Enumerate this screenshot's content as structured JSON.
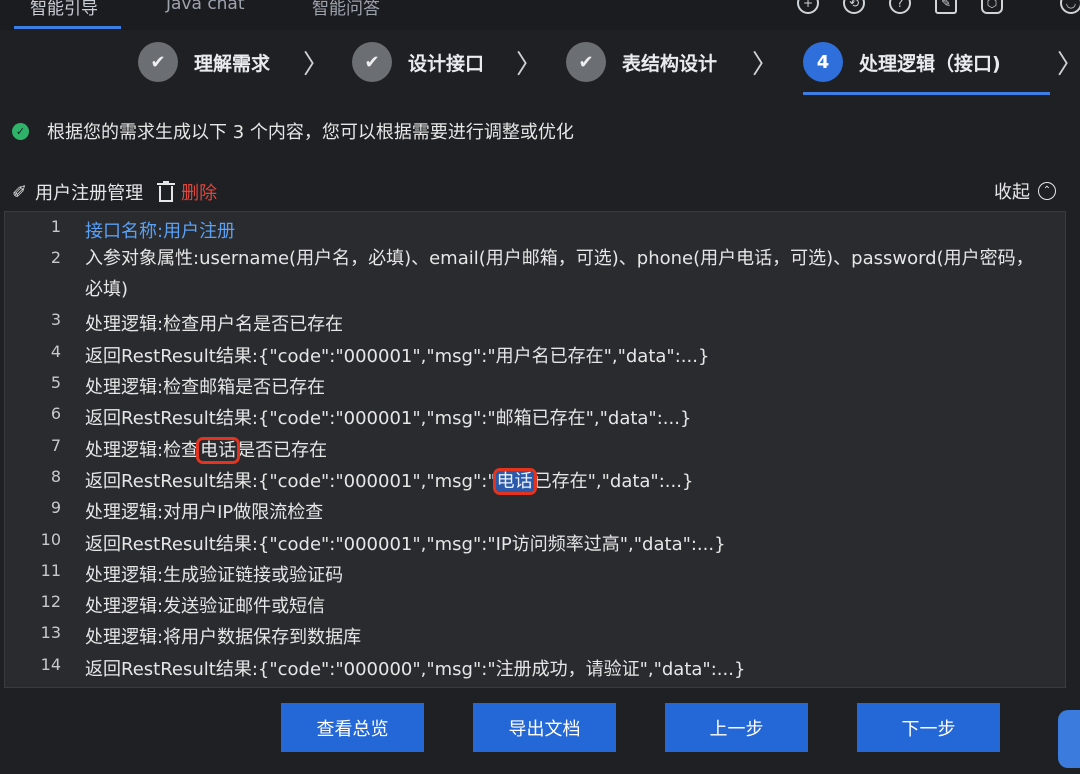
{
  "topnav": {
    "tabs": [
      "智能引导",
      "Java chat",
      "智能问答"
    ],
    "icons": [
      "add-icon",
      "history-icon",
      "help-icon",
      "edit-icon",
      "shield-icon",
      "user-icon"
    ]
  },
  "steps": [
    {
      "label": "理解需求",
      "state": "done",
      "mark": "✔"
    },
    {
      "label": "设计接口",
      "state": "done",
      "mark": "✔"
    },
    {
      "label": "表结构设计",
      "state": "done",
      "mark": "✔"
    },
    {
      "label": "处理逻辑（接口)",
      "state": "active",
      "mark": "4"
    }
  ],
  "info": {
    "text_before": "根据您的需求生成以下 ",
    "count": "3",
    "text_after": " 个内容，您可以根据需要进行调整或优化"
  },
  "section": {
    "title": "用户注册管理",
    "delete_label": "删除",
    "collapse_label": "收起"
  },
  "code_lines": [
    {
      "num": "1",
      "text": "接口名称:用户注册"
    },
    {
      "num": "2",
      "text": "入参对象属性:username(用户名，必填)、email(用户邮箱，可选)、phone(用户电话，可选)、password(用户密码，必填)"
    },
    {
      "num": "3",
      "text": "处理逻辑:检查用户名是否已存在"
    },
    {
      "num": "4",
      "text": "返回RestResult结果:{\"code\":\"000001\",\"msg\":\"用户名已存在\",\"data\":...}"
    },
    {
      "num": "5",
      "text": "处理逻辑:检查邮箱是否已存在"
    },
    {
      "num": "6",
      "text": "返回RestResult结果:{\"code\":\"000001\",\"msg\":\"邮箱已存在\",\"data\":...}"
    },
    {
      "num": "7",
      "pre": "处理逻辑:检查",
      "hl": "电话",
      "post": "是否已存在"
    },
    {
      "num": "8",
      "pre": "返回RestResult结果:{\"code\":\"000001\",\"msg\":\"",
      "hl": "电话",
      "post": "已存在\",\"data\":...}"
    },
    {
      "num": "9",
      "text": "处理逻辑:对用户IP做限流检查"
    },
    {
      "num": "10",
      "text": "返回RestResult结果:{\"code\":\"000001\",\"msg\":\"IP访问频率过高\",\"data\":...}"
    },
    {
      "num": "11",
      "text": "处理逻辑:生成验证链接或验证码"
    },
    {
      "num": "12",
      "text": "处理逻辑:发送验证邮件或短信"
    },
    {
      "num": "13",
      "text": "处理逻辑:将用户数据保存到数据库"
    },
    {
      "num": "14",
      "text": "返回RestResult结果:{\"code\":\"000000\",\"msg\":\"注册成功，请验证\",\"data\":...}"
    }
  ],
  "buttons": {
    "overview": "查看总览",
    "export": "导出文档",
    "prev": "上一步",
    "next": "下一步"
  },
  "colors": {
    "accent": "#2467d6",
    "danger": "#e0463a",
    "success": "#2fb36a",
    "highlight_border": "#e3341f"
  }
}
